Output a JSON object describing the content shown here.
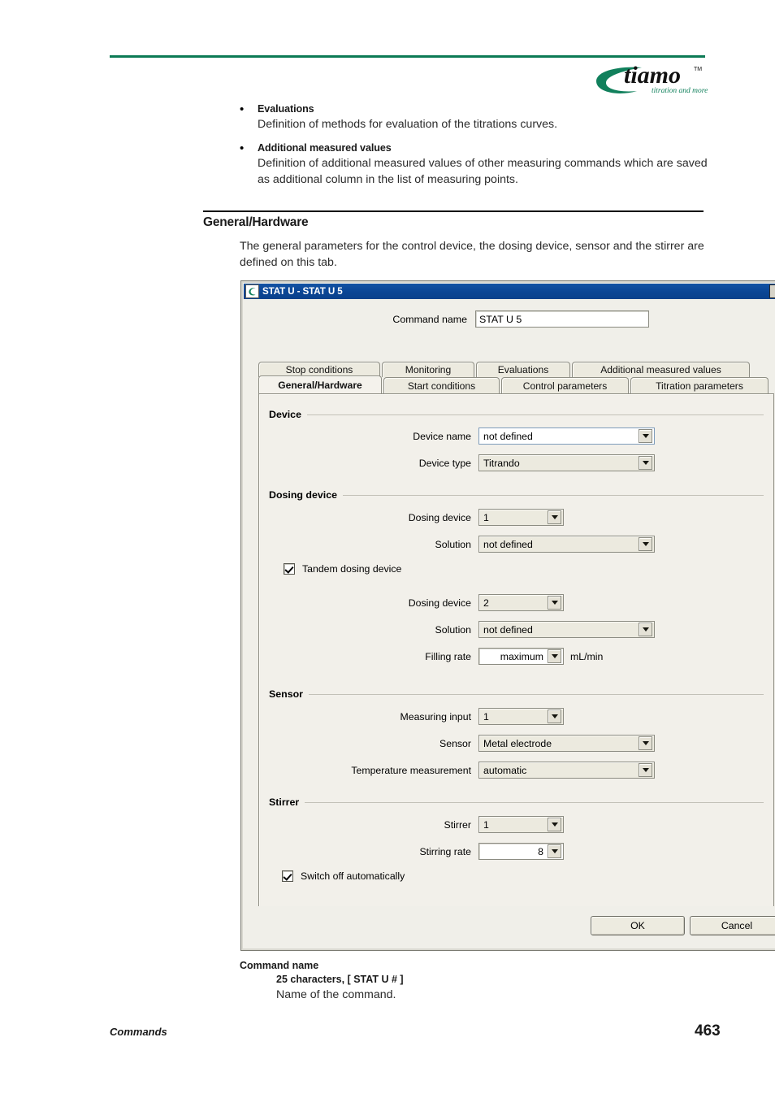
{
  "page": {
    "footer_left": "Commands",
    "footer_page": "463",
    "logo_text": "tiamo",
    "logo_tm": "TM",
    "logo_tagline": "titration and more",
    "accent_color": "#0c7a55"
  },
  "bullets": [
    {
      "title": "Evaluations",
      "text": "Definition of methods for evaluation of the titrations curves."
    },
    {
      "title": "Additional measured values",
      "text": "Definition of additional measured values of other measuring commands which are saved as additional column in the list of measuring points."
    }
  ],
  "section": {
    "heading": "General/Hardware",
    "paragraph": "The general parameters for the control device, the dosing device, sensor and the stirrer are defined on this tab."
  },
  "dialog": {
    "title": "STAT U - STAT U 5",
    "close_label": "×",
    "command_name_label": "Command name",
    "command_name_value": "STAT U 5",
    "titlebar_color": "#0a4594",
    "tabs_row1": [
      {
        "label": "Stop conditions",
        "active": false
      },
      {
        "label": "Monitoring",
        "active": false
      },
      {
        "label": "Evaluations",
        "active": false
      },
      {
        "label": "Additional measured values",
        "active": false
      }
    ],
    "tabs_row2": [
      {
        "label": "General/Hardware",
        "active": true
      },
      {
        "label": "Start conditions",
        "active": false
      },
      {
        "label": "Control parameters",
        "active": false
      },
      {
        "label": "Titration parameters",
        "active": false
      }
    ],
    "groups": {
      "device": {
        "title": "Device",
        "fields": [
          {
            "label": "Device name",
            "value": "not defined",
            "focused": true
          },
          {
            "label": "Device type",
            "value": "Titrando",
            "focused": false
          }
        ]
      },
      "dosing_device": {
        "title": "Dosing device",
        "fields": [
          {
            "label": "Dosing device",
            "value": "1"
          },
          {
            "label": "Solution",
            "value": "not defined"
          }
        ],
        "tandem_checkbox": {
          "label": "Tandem dosing device",
          "checked": true
        },
        "fields2": [
          {
            "label": "Dosing device",
            "value": "2"
          },
          {
            "label": "Solution",
            "value": "not defined"
          }
        ],
        "filling_rate": {
          "label": "Filling rate",
          "value": "maximum",
          "unit": "mL/min"
        }
      },
      "sensor": {
        "title": "Sensor",
        "fields": [
          {
            "label": "Measuring input",
            "value": "1"
          },
          {
            "label": "Sensor",
            "value": "Metal electrode"
          },
          {
            "label": "Temperature measurement",
            "value": "automatic"
          }
        ]
      },
      "stirrer": {
        "title": "Stirrer",
        "fields": [
          {
            "label": "Stirrer",
            "value": "1"
          }
        ],
        "stirring_rate": {
          "label": "Stirring rate",
          "value": "8"
        },
        "switch_off_checkbox": {
          "label": "Switch off automatically",
          "checked": true
        }
      }
    },
    "buttons": {
      "ok": "OK",
      "cancel": "Cancel"
    }
  },
  "description": {
    "term": "Command name",
    "spec": "25 characters, [ STAT U # ]",
    "text": "Name of the command."
  }
}
